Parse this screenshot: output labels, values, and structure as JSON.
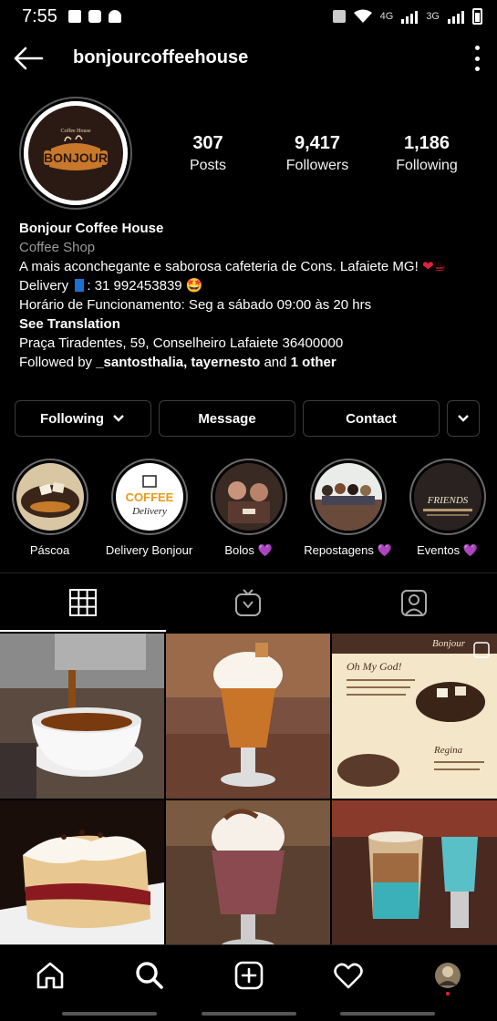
{
  "status_bar": {
    "time": "7:55",
    "net_label_1": "4G",
    "net_label_2": "3G"
  },
  "header": {
    "username": "bonjourcoffeehouse"
  },
  "profile": {
    "avatar_brand_top": "Coffee House",
    "avatar_brand_main": "BONJOUR",
    "stats": [
      {
        "value": "307",
        "label": "Posts"
      },
      {
        "value": "9,417",
        "label": "Followers"
      },
      {
        "value": "1,186",
        "label": "Following"
      }
    ]
  },
  "bio": {
    "name": "Bonjour Coffee House",
    "category": "Coffee Shop",
    "line1": "A mais aconchegante e saborosa cafeteria de Cons. Lafaiete MG! ",
    "line1_emoji": "❤☕",
    "line2_prefix": "Delivery",
    "line2_rest": ": 31 992453839 🤩",
    "line3": "Horário de Funcionamento: Seg a sábado 09:00 às 20 hrs",
    "see_translation": "See Translation",
    "address": "Praça Tiradentes, 59, Conselheiro Lafaiete 36400000",
    "followed_by_prefix": "Followed by ",
    "followed_by_users": "_santosthalia, tayernesto",
    "followed_by_and": " and ",
    "followed_by_other": "1 other"
  },
  "buttons": {
    "following": "Following",
    "message": "Message",
    "contact": "Contact"
  },
  "highlights": [
    {
      "label": "Páscoa"
    },
    {
      "label": "Delivery Bonjour"
    },
    {
      "label": "Bolos 💜"
    },
    {
      "label": "Repostagens 💜"
    },
    {
      "label": "Eventos 💜"
    }
  ],
  "highlight_texts": {
    "coffee": "COFFEE",
    "delivery": "Delivery",
    "friends": "FRIENDS"
  },
  "grid_post3": {
    "title": "Oh My God!",
    "brand": "Bonjour",
    "sub": "Regina"
  },
  "colors": {
    "background": "#000000",
    "accent_heart": "#e0233b",
    "muted_text": "#9a9a9a",
    "button_border": "#3c3c3c"
  },
  "icons": [
    "back-arrow-icon",
    "more-vert-icon",
    "grid-icon",
    "igtv-icon",
    "tagged-icon",
    "home-icon",
    "search-icon",
    "add-icon",
    "heart-icon"
  ]
}
